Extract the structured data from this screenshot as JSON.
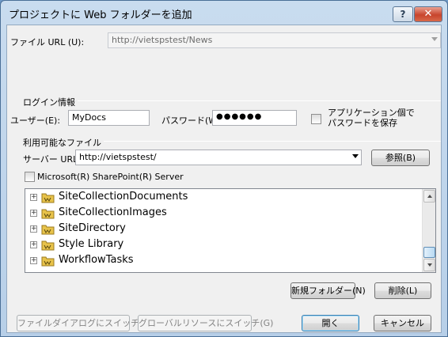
{
  "window": {
    "title": "プロジェクトに Web フォルダーを追加",
    "help_label": "?",
    "close_label": "✕"
  },
  "file_url": {
    "label": "ファイル URL (U):",
    "value": "http://vietspstest/News"
  },
  "login": {
    "group_title": "ログイン情報",
    "user_label": "ユーザー(E):",
    "user_value": "MyDocs",
    "password_label": "パスワード(W):",
    "password_value": "●●●●●●",
    "save_password_label_line1": "アプリケーション個で",
    "save_password_label_line2": "パスワードを保存"
  },
  "available_files": {
    "group_title": "利用可能なファイル",
    "server_url_label": "サーバー URL",
    "server_url_value": "http://vietspstest/",
    "browse_button": "参照(B)",
    "sharepoint_checkbox_label": "Microsoft(R) SharePoint(R) Server",
    "tree_items": [
      {
        "label": "SiteCollectionDocuments"
      },
      {
        "label": "SiteCollectionImages"
      },
      {
        "label": "SiteDirectory"
      },
      {
        "label": "Style Library"
      },
      {
        "label": "WorkflowTasks"
      }
    ],
    "new_folder_button": "新規フォルダー(N)",
    "delete_button": "削除(L)"
  },
  "footer": {
    "switch_file_dialog_button": "ファイルダイアログにスイッチ(F)",
    "switch_global_button": "グローバルリソースにスイッチ(G)",
    "open_button": "開く",
    "cancel_button": "キャンセル"
  },
  "colors": {
    "title_bar": "#b7cfe8",
    "close_button": "#c8452d",
    "folder_yellow": "#e8c34a"
  }
}
